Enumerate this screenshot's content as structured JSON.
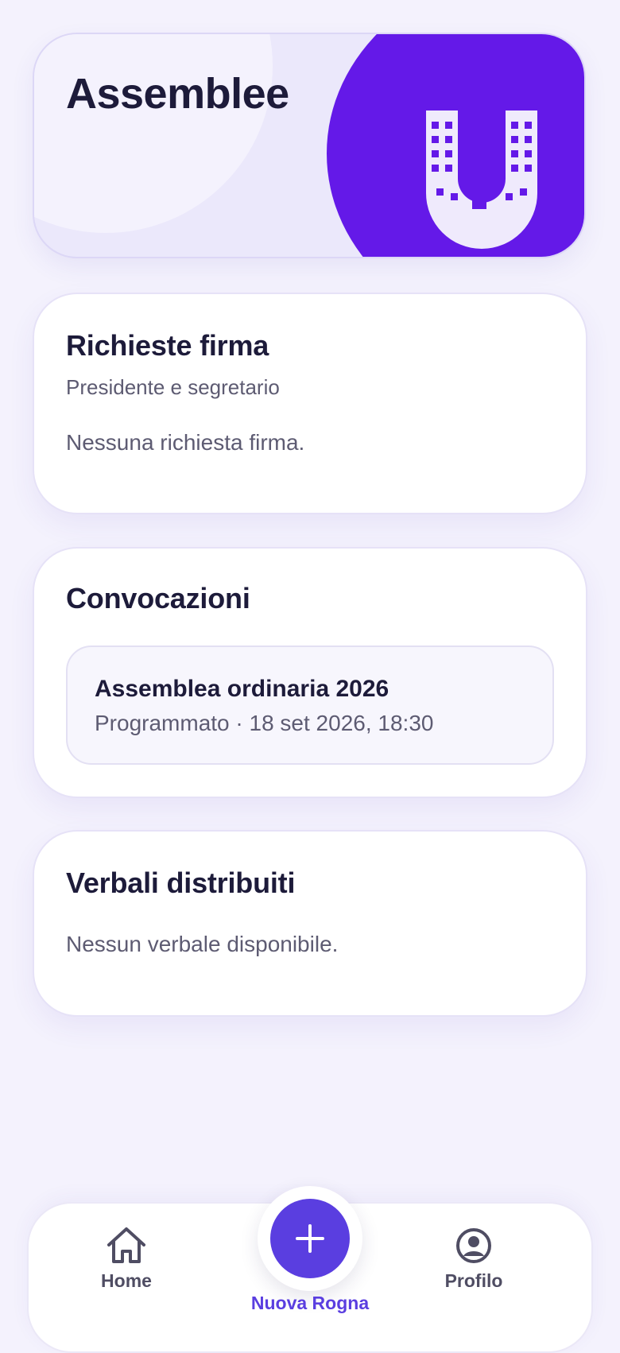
{
  "header": {
    "title": "Assemblee",
    "logo": "building-u-logo"
  },
  "firma": {
    "title": "Richieste firma",
    "subtitle": "Presidente e segretario",
    "empty": "Nessuna richiesta firma."
  },
  "convocazioni": {
    "title": "Convocazioni",
    "items": [
      {
        "title": "Assemblea ordinaria 2026",
        "meta": "Programmato · 18 set 2026, 18:30"
      }
    ]
  },
  "verbali": {
    "title": "Verbali distribuiti",
    "empty": "Nessun verbale disponibile."
  },
  "nav": {
    "home": {
      "label": "Home",
      "icon": "home-icon"
    },
    "fab": {
      "label": "Nuova Rogna",
      "icon": "plus-icon"
    },
    "profilo": {
      "label": "Profilo",
      "icon": "user-circle-icon"
    }
  },
  "colors": {
    "accent": "#5a3ee0",
    "hero_purple": "#6419e8",
    "background": "#f4f2fd"
  }
}
